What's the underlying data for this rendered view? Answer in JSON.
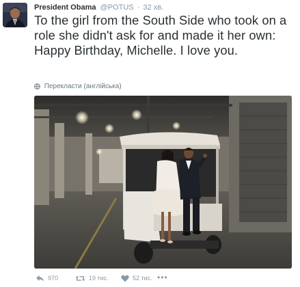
{
  "tweet": {
    "author_name": "President Obama",
    "author_handle": "@POTUS",
    "separator": "·",
    "timestamp": "32 хв.",
    "text": "To the girl from the South Side who took on a role she didn't ask for and made it her own: Happy Birthday, Michelle. I love you.",
    "translate_label": "Перекласти (англійська)"
  },
  "actions": {
    "reply_count": "970",
    "retweet_count": "19 тис.",
    "like_count": "52 тис.",
    "more_label": "•••"
  },
  "icons": {
    "avatar": "avatar-photo",
    "globe": "globe-icon",
    "reply": "reply-icon",
    "retweet": "retweet-icon",
    "like": "heart-icon",
    "more": "more-icon"
  },
  "colors": {
    "text": "#292f33",
    "muted": "#8899a6",
    "translate": "#66757f"
  }
}
